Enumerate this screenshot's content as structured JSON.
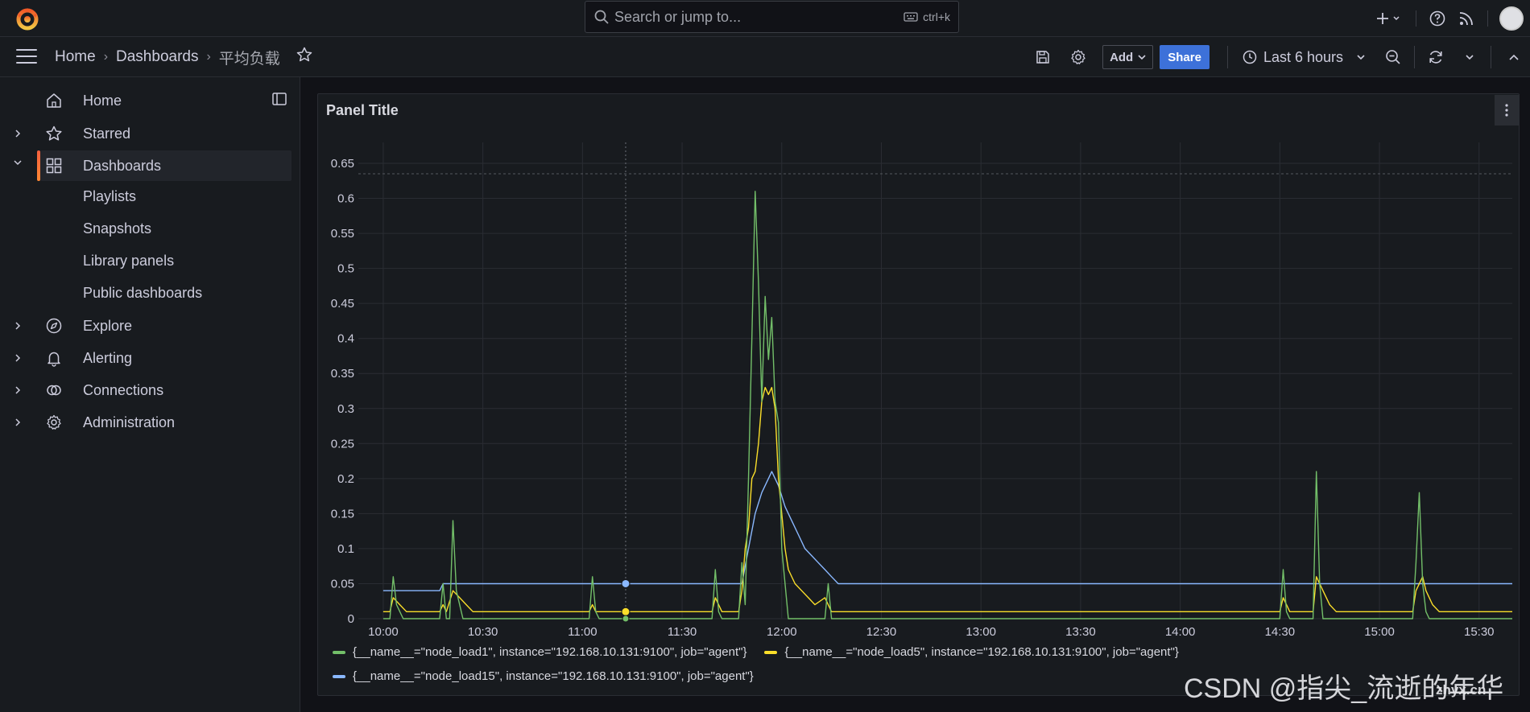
{
  "topbar": {
    "search_placeholder": "Search or jump to...",
    "search_shortcut": "ctrl+k"
  },
  "breadcrumb": {
    "home": "Home",
    "dashboards": "Dashboards",
    "current": "平均负载"
  },
  "toolbar": {
    "add_label": "Add",
    "share_label": "Share",
    "time_range": "Last 6 hours"
  },
  "sidebar": {
    "items": [
      {
        "label": "Home"
      },
      {
        "label": "Starred"
      },
      {
        "label": "Dashboards"
      },
      {
        "label": "Playlists"
      },
      {
        "label": "Snapshots"
      },
      {
        "label": "Library panels"
      },
      {
        "label": "Public dashboards"
      },
      {
        "label": "Explore"
      },
      {
        "label": "Alerting"
      },
      {
        "label": "Connections"
      },
      {
        "label": "Administration"
      }
    ]
  },
  "panel": {
    "title": "Panel Title"
  },
  "colors": {
    "series_green": "#73bf69",
    "series_yellow": "#fade2a",
    "series_blue": "#8ab8ff",
    "accent": "#f55f3e"
  },
  "chart_data": {
    "type": "line",
    "x_unit": "time HH:MM",
    "x_ticks": [
      "10:00",
      "10:30",
      "11:00",
      "11:30",
      "12:00",
      "12:30",
      "13:00",
      "13:30",
      "14:00",
      "14:30",
      "15:00",
      "15:30"
    ],
    "y_ticks": [
      "0",
      "0.05",
      "0.1",
      "0.15",
      "0.2",
      "0.25",
      "0.3",
      "0.35",
      "0.4",
      "0.45",
      "0.5",
      "0.55",
      "0.6",
      "0.65"
    ],
    "ylim": [
      0,
      0.65
    ],
    "xlim": [
      "10:00",
      "15:40"
    ],
    "grid": true,
    "legend_position": "bottom",
    "series": [
      {
        "name": "{__name__=\"node_load1\", instance=\"192.168.10.131:9100\", job=\"agent\"}",
        "points": [
          [
            "10:00",
            0
          ],
          [
            "10:02",
            0
          ],
          [
            "10:03",
            0.06
          ],
          [
            "10:04",
            0.02
          ],
          [
            "10:06",
            0
          ],
          [
            "10:17",
            0
          ],
          [
            "10:18",
            0.05
          ],
          [
            "10:19",
            0
          ],
          [
            "10:20",
            0
          ],
          [
            "10:21",
            0.14
          ],
          [
            "10:22",
            0.04
          ],
          [
            "10:24",
            0
          ],
          [
            "11:02",
            0
          ],
          [
            "11:03",
            0.06
          ],
          [
            "11:04",
            0.01
          ],
          [
            "11:05",
            0
          ],
          [
            "11:39",
            0
          ],
          [
            "11:40",
            0.07
          ],
          [
            "11:41",
            0.01
          ],
          [
            "11:42",
            0
          ],
          [
            "11:47",
            0
          ],
          [
            "11:48",
            0.08
          ],
          [
            "11:49",
            0.02
          ],
          [
            "11:50",
            0.2
          ],
          [
            "11:51",
            0.4
          ],
          [
            "11:52",
            0.61
          ],
          [
            "11:53",
            0.48
          ],
          [
            "11:54",
            0.31
          ],
          [
            "11:55",
            0.46
          ],
          [
            "11:56",
            0.37
          ],
          [
            "11:57",
            0.43
          ],
          [
            "11:58",
            0.31
          ],
          [
            "11:59",
            0.28
          ],
          [
            "12:00",
            0.1
          ],
          [
            "12:01",
            0.05
          ],
          [
            "12:02",
            0
          ],
          [
            "12:13",
            0
          ],
          [
            "12:14",
            0.05
          ],
          [
            "12:15",
            0
          ],
          [
            "14:30",
            0
          ],
          [
            "14:31",
            0.07
          ],
          [
            "14:32",
            0.01
          ],
          [
            "14:33",
            0
          ],
          [
            "14:40",
            0
          ],
          [
            "14:41",
            0.21
          ],
          [
            "14:42",
            0.05
          ],
          [
            "14:43",
            0
          ],
          [
            "15:10",
            0
          ],
          [
            "15:11",
            0.08
          ],
          [
            "15:12",
            0.18
          ],
          [
            "15:13",
            0.05
          ],
          [
            "15:14",
            0.01
          ],
          [
            "15:15",
            0
          ],
          [
            "15:40",
            0
          ]
        ]
      },
      {
        "name": "{__name__=\"node_load5\", instance=\"192.168.10.131:9100\", job=\"agent\"}",
        "points": [
          [
            "10:00",
            0.01
          ],
          [
            "10:02",
            0.01
          ],
          [
            "10:03",
            0.03
          ],
          [
            "10:05",
            0.02
          ],
          [
            "10:07",
            0.01
          ],
          [
            "10:17",
            0.01
          ],
          [
            "10:18",
            0.02
          ],
          [
            "10:19",
            0.01
          ],
          [
            "10:21",
            0.04
          ],
          [
            "10:23",
            0.03
          ],
          [
            "10:25",
            0.02
          ],
          [
            "10:27",
            0.01
          ],
          [
            "11:02",
            0.01
          ],
          [
            "11:03",
            0.02
          ],
          [
            "11:04",
            0.01
          ],
          [
            "11:39",
            0.01
          ],
          [
            "11:40",
            0.03
          ],
          [
            "11:42",
            0.01
          ],
          [
            "11:47",
            0.01
          ],
          [
            "11:48",
            0.04
          ],
          [
            "11:49",
            0.1
          ],
          [
            "11:50",
            0.13
          ],
          [
            "11:51",
            0.2
          ],
          [
            "11:52",
            0.21
          ],
          [
            "11:53",
            0.25
          ],
          [
            "11:54",
            0.31
          ],
          [
            "11:55",
            0.33
          ],
          [
            "11:56",
            0.32
          ],
          [
            "11:57",
            0.33
          ],
          [
            "11:58",
            0.3
          ],
          [
            "11:59",
            0.2
          ],
          [
            "12:00",
            0.15
          ],
          [
            "12:01",
            0.1
          ],
          [
            "12:02",
            0.07
          ],
          [
            "12:04",
            0.05
          ],
          [
            "12:06",
            0.04
          ],
          [
            "12:08",
            0.03
          ],
          [
            "12:10",
            0.02
          ],
          [
            "12:13",
            0.03
          ],
          [
            "12:15",
            0.01
          ],
          [
            "14:30",
            0.01
          ],
          [
            "14:31",
            0.03
          ],
          [
            "14:33",
            0.01
          ],
          [
            "14:40",
            0.01
          ],
          [
            "14:41",
            0.06
          ],
          [
            "14:43",
            0.04
          ],
          [
            "14:45",
            0.02
          ],
          [
            "14:47",
            0.01
          ],
          [
            "15:10",
            0.01
          ],
          [
            "15:11",
            0.04
          ],
          [
            "15:13",
            0.06
          ],
          [
            "15:14",
            0.04
          ],
          [
            "15:16",
            0.02
          ],
          [
            "15:18",
            0.01
          ],
          [
            "15:40",
            0.01
          ]
        ]
      },
      {
        "name": "{__name__=\"node_load15\", instance=\"192.168.10.131:9100\", job=\"agent\"}",
        "points": [
          [
            "10:00",
            0.04
          ],
          [
            "10:17",
            0.04
          ],
          [
            "10:18",
            0.05
          ],
          [
            "11:48",
            0.05
          ],
          [
            "11:50",
            0.1
          ],
          [
            "11:52",
            0.15
          ],
          [
            "11:54",
            0.18
          ],
          [
            "11:56",
            0.2
          ],
          [
            "11:57",
            0.21
          ],
          [
            "11:59",
            0.19
          ],
          [
            "12:01",
            0.16
          ],
          [
            "12:03",
            0.14
          ],
          [
            "12:05",
            0.12
          ],
          [
            "12:07",
            0.1
          ],
          [
            "12:09",
            0.09
          ],
          [
            "12:11",
            0.08
          ],
          [
            "12:13",
            0.07
          ],
          [
            "12:15",
            0.06
          ],
          [
            "12:17",
            0.05
          ],
          [
            "15:40",
            0.05
          ]
        ]
      }
    ]
  },
  "watermark": {
    "text": "CSDN @指尖_流逝的年华",
    "site": "zhyx.cn"
  }
}
